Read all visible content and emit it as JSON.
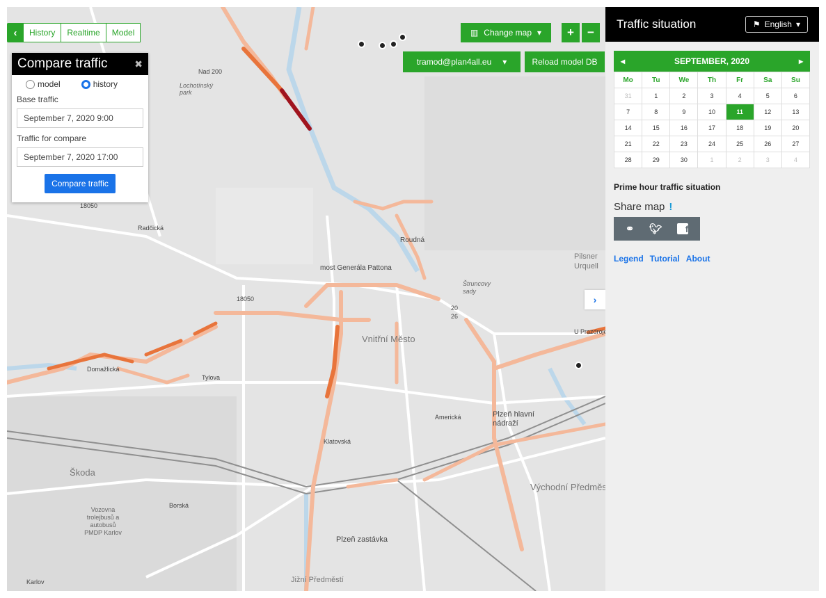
{
  "mode": {
    "back_icon": "chevron-left-icon",
    "tabs": [
      "History",
      "Realtime",
      "Model"
    ]
  },
  "compare": {
    "title": "Compare traffic",
    "close_icon": "close-icon",
    "radio_model": "model",
    "radio_history": "history",
    "selected": "history",
    "base_label": "Base traffic",
    "base_value": "September 7, 2020 9:00",
    "compare_label": "Traffic for compare",
    "compare_value": "September 7, 2020 17:00",
    "button": "Compare traffic"
  },
  "map_controls": {
    "change_map": "Change map",
    "zoom_in": "+",
    "zoom_out": "−",
    "user": "tramod@plan4all.eu",
    "reload": "Reload model DB",
    "expand_icon": "chevron-right-icon"
  },
  "map_labels": {
    "vnitrni": "Vnitřní Město",
    "skoda": "Škoda",
    "pilsner": "Pilsner Urquell",
    "plzen_hl": "Plzeň hlavní nádraží",
    "vychodni": "Východní Předměstí",
    "plzen_zast": "Plzeň zastávka",
    "jizni": "Jižní Předměstí",
    "most": "most Generála Pattona",
    "roudna": "Roudná",
    "vozovna": "Vozovna trolejbusů a autobusů PMDP Karlov",
    "karlov": "Karlov",
    "lochotinsky": "Lochotínský park",
    "strunc": "Štruncovy sady",
    "americka": "Americká",
    "tylova": "Tylova",
    "klatovska": "Klatovská",
    "borska": "Borská",
    "n18050": "18050",
    "n18050b": "18050",
    "radcicka": "Radčická",
    "doubravecka": "Domažlická",
    "uprazdroje": "U Prazdroje",
    "n20": "20",
    "n26": "26",
    "nad200": "Nad 200"
  },
  "sidebar": {
    "title": "Traffic situation",
    "language": "English",
    "lang_icon": "flag-icon",
    "calendar": {
      "month": "SEPTEMBER, 2020",
      "weekdays": [
        "Mo",
        "Tu",
        "We",
        "Th",
        "Fr",
        "Sa",
        "Su"
      ],
      "weeks": [
        [
          "31",
          "1",
          "2",
          "3",
          "4",
          "5",
          "6"
        ],
        [
          "7",
          "8",
          "9",
          "10",
          "11",
          "12",
          "13"
        ],
        [
          "14",
          "15",
          "16",
          "17",
          "18",
          "19",
          "20"
        ],
        [
          "21",
          "22",
          "23",
          "24",
          "25",
          "26",
          "27"
        ],
        [
          "28",
          "29",
          "30",
          "1",
          "2",
          "3",
          "4"
        ]
      ],
      "selected": "11"
    },
    "prime": "Prime hour traffic situation",
    "share_label": "Share map",
    "share_alert": "!",
    "share_icons": [
      "link-icon",
      "twitter-icon",
      "facebook-icon"
    ],
    "links": [
      "Legend",
      "Tutorial",
      "About"
    ]
  },
  "colors": {
    "green": "#2aa52a",
    "blue": "#1a73e8",
    "traffic_light": "#f4b89a",
    "traffic_mid": "#e8743b",
    "traffic_heavy": "#a0141e"
  }
}
